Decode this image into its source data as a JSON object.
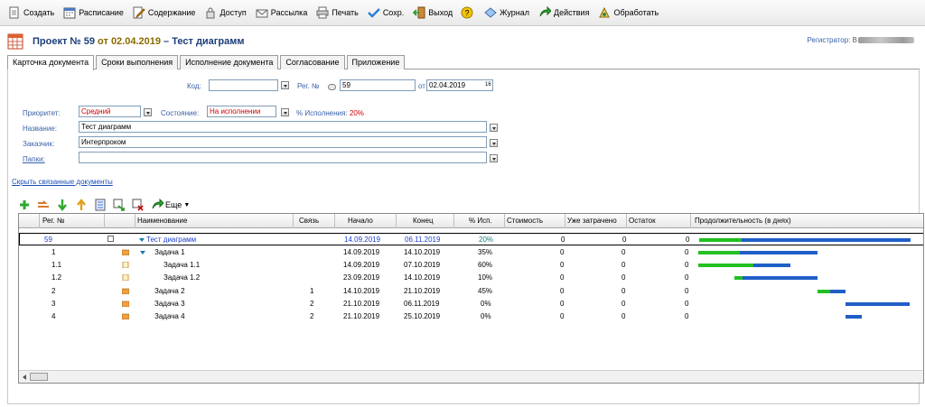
{
  "toolbar": {
    "create": "Создать",
    "schedule": "Расписание",
    "content": "Содержание",
    "access": "Доступ",
    "mailing": "Рассылка",
    "print": "Печать",
    "save": "Сохр.",
    "exit": "Выход",
    "journal": "Журнал",
    "actions": "Действия",
    "process": "Обработать"
  },
  "header": {
    "prefix": "Проект № ",
    "number": "59",
    "from": " от ",
    "date": "02.04.2019",
    "dash": " – ",
    "name": "Тест диаграмм",
    "registrar_label": "Регистратор:",
    "registrar_value": "В"
  },
  "tabs": [
    {
      "label": "Карточка документа"
    },
    {
      "label": "Сроки выполнения"
    },
    {
      "label": "Исполнение документа"
    },
    {
      "label": "Согласование"
    },
    {
      "label": "Приложение"
    }
  ],
  "form": {
    "code_label": "Код:",
    "code_value": "",
    "reg_label": "Рег. №",
    "reg_value": "59",
    "from_label": "от",
    "from_value": "02.04.2019",
    "cal": "16",
    "priority_label": "Приоритет:",
    "priority_value": "Средний",
    "state_label": "Состояние:",
    "state_value": "На исполнении",
    "pct_label": "% Исполнения: ",
    "pct_value": "20%",
    "name_label": "Название:",
    "name_value": "Тест диаграмм",
    "customer_label": "Заказчик:",
    "customer_value": "Интерпроком",
    "folders_label": "Папки:",
    "folders_value": "",
    "hide_link": "Скрыть связанные документы"
  },
  "grid_tools": {
    "more": "Еще"
  },
  "grid": {
    "columns": [
      "Рег. №",
      "Наименование",
      "Связь",
      "Начало",
      "Конец",
      "% Исп.",
      "Стоимость",
      "Уже затрачено",
      "Остаток",
      "Продолжительность (в днях)"
    ],
    "rows": [
      {
        "reg": "59",
        "name": "Тест диаграмм",
        "link": "",
        "start": "14.09.2019",
        "end": "06.11.2019",
        "pct": "20%",
        "cost": "0",
        "spent": "0",
        "rest": "0",
        "done": 0.2
      },
      {
        "reg": "1",
        "name": "Задача 1",
        "link": "",
        "start": "14.09.2019",
        "end": "14.10.2019",
        "pct": "35%",
        "cost": "0",
        "spent": "0",
        "rest": "0",
        "done": 0.35
      },
      {
        "reg": "1.1",
        "name": "Задача 1.1",
        "link": "",
        "start": "14.09.2019",
        "end": "07.10.2019",
        "pct": "60%",
        "cost": "0",
        "spent": "0",
        "rest": "0",
        "done": 0.6
      },
      {
        "reg": "1.2",
        "name": "Задача 1.2",
        "link": "",
        "start": "23.09.2019",
        "end": "14.10.2019",
        "pct": "10%",
        "cost": "0",
        "spent": "0",
        "rest": "0",
        "done": 0.1
      },
      {
        "reg": "2",
        "name": "Задача 2",
        "link": "1",
        "start": "14.10.2019",
        "end": "21.10.2019",
        "pct": "45%",
        "cost": "0",
        "spent": "0",
        "rest": "0",
        "done": 0.45
      },
      {
        "reg": "3",
        "name": "Задача 3",
        "link": "2",
        "start": "21.10.2019",
        "end": "06.11.2019",
        "pct": "0%",
        "cost": "0",
        "spent": "0",
        "rest": "0",
        "done": 0
      },
      {
        "reg": "4",
        "name": "Задача 4",
        "link": "2",
        "start": "21.10.2019",
        "end": "25.10.2019",
        "pct": "0%",
        "cost": "0",
        "spent": "0",
        "rest": "0",
        "done": 0
      }
    ]
  },
  "colors": {
    "gantt_done": "#22c022",
    "gantt_rest": "#1f5fc8",
    "accent_red": "#d00000",
    "label_blue": "#3a61a8"
  }
}
